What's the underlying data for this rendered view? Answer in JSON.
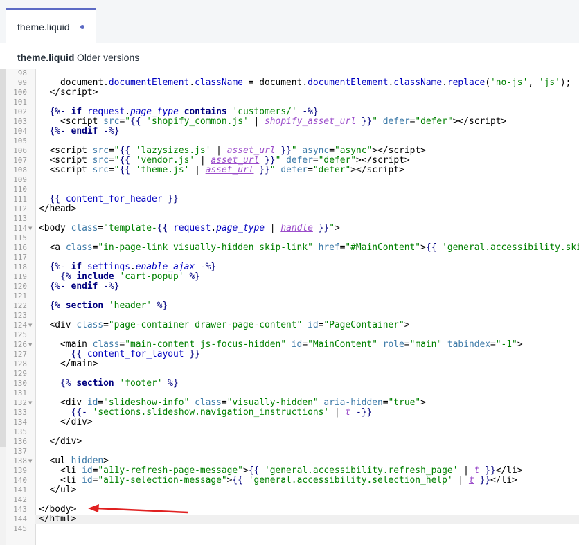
{
  "tab": {
    "label": "theme.liquid"
  },
  "header": {
    "file_title": "theme.liquid",
    "older_versions": "Older versions"
  },
  "colors": {
    "accent": "#5c6ac4",
    "arrow": "#e02020"
  },
  "editor": {
    "active_line": 144,
    "lines": [
      {
        "n": "98",
        "fold": false,
        "html": ""
      },
      {
        "n": "99",
        "fold": false,
        "html": "    document.<span class=\"v\">documentElement</span>.<span class=\"v\">className</span> = document.<span class=\"v\">documentElement</span>.<span class=\"v\">className</span>.<span class=\"v\">replace</span>(<span class=\"s\">'no-js'</span>, <span class=\"s\">'js'</span>);"
      },
      {
        "n": "100",
        "fold": false,
        "html": "  &lt;/script&gt;"
      },
      {
        "n": "101",
        "fold": false,
        "html": ""
      },
      {
        "n": "102",
        "fold": false,
        "html": "  <span class=\"l\">{%-</span> <span class=\"k\">if</span> <span class=\"v\">request</span>.<span class=\"i\">page_type</span> <span class=\"k\">contains</span> <span class=\"s\">'customers/'</span> <span class=\"l\">-%}</span>"
      },
      {
        "n": "103",
        "fold": false,
        "html": "    &lt;script <span class=\"a\">src</span>=<span class=\"s\">\"</span><span class=\"l\">{{</span> <span class=\"s\">'shopify_common.js'</span> | <span class=\"f\">shopify_asset_url</span> <span class=\"l\">}}</span><span class=\"s\">\"</span> <span class=\"a\">defer</span>=<span class=\"s\">\"defer\"</span>&gt;&lt;/script&gt;"
      },
      {
        "n": "104",
        "fold": false,
        "html": "  <span class=\"l\">{%-</span> <span class=\"k\">endif</span> <span class=\"l\">-%}</span>"
      },
      {
        "n": "105",
        "fold": false,
        "html": ""
      },
      {
        "n": "106",
        "fold": false,
        "html": "  &lt;script <span class=\"a\">src</span>=<span class=\"s\">\"</span><span class=\"l\">{{</span> <span class=\"s\">'lazysizes.js'</span> | <span class=\"f\">asset_url</span> <span class=\"l\">}}</span><span class=\"s\">\"</span> <span class=\"a\">async</span>=<span class=\"s\">\"async\"</span>&gt;&lt;/script&gt;"
      },
      {
        "n": "107",
        "fold": false,
        "html": "  &lt;script <span class=\"a\">src</span>=<span class=\"s\">\"</span><span class=\"l\">{{</span> <span class=\"s\">'vendor.js'</span> | <span class=\"f\">asset_url</span> <span class=\"l\">}}</span><span class=\"s\">\"</span> <span class=\"a\">defer</span>=<span class=\"s\">\"defer\"</span>&gt;&lt;/script&gt;"
      },
      {
        "n": "108",
        "fold": false,
        "html": "  &lt;script <span class=\"a\">src</span>=<span class=\"s\">\"</span><span class=\"l\">{{</span> <span class=\"s\">'theme.js'</span> | <span class=\"f\">asset_url</span> <span class=\"l\">}}</span><span class=\"s\">\"</span> <span class=\"a\">defer</span>=<span class=\"s\">\"defer\"</span>&gt;&lt;/script&gt;"
      },
      {
        "n": "109",
        "fold": false,
        "html": ""
      },
      {
        "n": "110",
        "fold": false,
        "html": ""
      },
      {
        "n": "111",
        "fold": false,
        "html": "  <span class=\"l\">{{</span> <span class=\"v\">content_for_header</span> <span class=\"l\">}}</span>"
      },
      {
        "n": "112",
        "fold": false,
        "html": "&lt;/head&gt;"
      },
      {
        "n": "113",
        "fold": false,
        "html": ""
      },
      {
        "n": "114",
        "fold": true,
        "html": "&lt;body <span class=\"a\">class</span>=<span class=\"s\">\"template-</span><span class=\"l\">{{</span> <span class=\"v\">request</span>.<span class=\"i\">page_type</span> | <span class=\"f\">handle</span> <span class=\"l\">}}</span><span class=\"s\">\"</span>&gt;"
      },
      {
        "n": "115",
        "fold": false,
        "html": ""
      },
      {
        "n": "116",
        "fold": false,
        "html": "  &lt;a <span class=\"a\">class</span>=<span class=\"s\">\"in-page-link visually-hidden skip-link\"</span> <span class=\"a\">href</span>=<span class=\"s\">\"#MainContent\"</span>&gt;<span class=\"l\">{{</span> <span class=\"s\">'general.accessibility.skip_to_content'</span> | <span class=\"f\">t</span> <span class=\"l\">}}</span>&lt;/a&gt;"
      },
      {
        "n": "117",
        "fold": false,
        "html": ""
      },
      {
        "n": "118",
        "fold": false,
        "html": "  <span class=\"l\">{%-</span> <span class=\"k\">if</span> <span class=\"v\">settings</span>.<span class=\"i\">enable_ajax</span> <span class=\"l\">-%}</span>"
      },
      {
        "n": "119",
        "fold": false,
        "html": "    <span class=\"l\">{%</span> <span class=\"k\">include</span> <span class=\"s\">'cart-popup'</span> <span class=\"l\">%}</span>"
      },
      {
        "n": "120",
        "fold": false,
        "html": "  <span class=\"l\">{%-</span> <span class=\"k\">endif</span> <span class=\"l\">-%}</span>"
      },
      {
        "n": "121",
        "fold": false,
        "html": ""
      },
      {
        "n": "122",
        "fold": false,
        "html": "  <span class=\"l\">{%</span> <span class=\"k\">section</span> <span class=\"s\">'header'</span> <span class=\"l\">%}</span>"
      },
      {
        "n": "123",
        "fold": false,
        "html": ""
      },
      {
        "n": "124",
        "fold": true,
        "html": "  &lt;div <span class=\"a\">class</span>=<span class=\"s\">\"page-container drawer-page-content\"</span> <span class=\"a\">id</span>=<span class=\"s\">\"PageContainer\"</span>&gt;"
      },
      {
        "n": "125",
        "fold": false,
        "html": ""
      },
      {
        "n": "126",
        "fold": true,
        "html": "    &lt;main <span class=\"a\">class</span>=<span class=\"s\">\"main-content js-focus-hidden\"</span> <span class=\"a\">id</span>=<span class=\"s\">\"MainContent\"</span> <span class=\"a\">role</span>=<span class=\"s\">\"main\"</span> <span class=\"a\">tabindex</span>=<span class=\"s\">\"-1\"</span>&gt;"
      },
      {
        "n": "127",
        "fold": false,
        "html": "      <span class=\"l\">{{</span> <span class=\"v\">content_for_layout</span> <span class=\"l\">}}</span>"
      },
      {
        "n": "128",
        "fold": false,
        "html": "    &lt;/main&gt;"
      },
      {
        "n": "129",
        "fold": false,
        "html": ""
      },
      {
        "n": "130",
        "fold": false,
        "html": "    <span class=\"l\">{%</span> <span class=\"k\">section</span> <span class=\"s\">'footer'</span> <span class=\"l\">%}</span>"
      },
      {
        "n": "131",
        "fold": false,
        "html": ""
      },
      {
        "n": "132",
        "fold": true,
        "html": "    &lt;div <span class=\"a\">id</span>=<span class=\"s\">\"slideshow-info\"</span> <span class=\"a\">class</span>=<span class=\"s\">\"visually-hidden\"</span> <span class=\"a\">aria-hidden</span>=<span class=\"s\">\"true\"</span>&gt;"
      },
      {
        "n": "133",
        "fold": false,
        "html": "      <span class=\"l\">{{-</span> <span class=\"s\">'sections.slideshow.navigation_instructions'</span> | <span class=\"f\">t</span> <span class=\"l\">-}}</span>"
      },
      {
        "n": "134",
        "fold": false,
        "html": "    &lt;/div&gt;"
      },
      {
        "n": "135",
        "fold": false,
        "html": ""
      },
      {
        "n": "136",
        "fold": false,
        "html": "  &lt;/div&gt;"
      },
      {
        "n": "137",
        "fold": false,
        "html": ""
      },
      {
        "n": "138",
        "fold": true,
        "html": "  &lt;ul <span class=\"a\">hidden</span>&gt;"
      },
      {
        "n": "139",
        "fold": false,
        "html": "    &lt;li <span class=\"a\">id</span>=<span class=\"s\">\"a11y-refresh-page-message\"</span>&gt;<span class=\"l\">{{</span> <span class=\"s\">'general.accessibility.refresh_page'</span> | <span class=\"f\">t</span> <span class=\"l\">}}</span>&lt;/li&gt;"
      },
      {
        "n": "140",
        "fold": false,
        "html": "    &lt;li <span class=\"a\">id</span>=<span class=\"s\">\"a11y-selection-message\"</span>&gt;<span class=\"l\">{{</span> <span class=\"s\">'general.accessibility.selection_help'</span> | <span class=\"f\">t</span> <span class=\"l\">}}</span>&lt;/li&gt;"
      },
      {
        "n": "141",
        "fold": false,
        "html": "  &lt;/ul&gt;"
      },
      {
        "n": "142",
        "fold": false,
        "html": ""
      },
      {
        "n": "143",
        "fold": false,
        "html": "&lt;/body&gt;"
      },
      {
        "n": "144",
        "fold": false,
        "html": "&lt;/html&gt;"
      },
      {
        "n": "145",
        "fold": false,
        "html": ""
      }
    ]
  }
}
